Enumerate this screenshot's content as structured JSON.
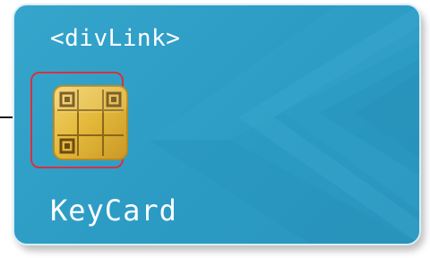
{
  "card": {
    "title": "<divLink>",
    "brand_label": "KeyCard"
  },
  "colors": {
    "card_base": "#2b9bc4",
    "card_highlight": "#36a5cc",
    "chip_gold": "#e3b83a",
    "chip_dark": "#6b4b10",
    "highlight_border": "#d9313e"
  },
  "icons": {
    "chip": "smart-card-chip-icon",
    "chevron_decoration": "chevron-left-icon"
  }
}
